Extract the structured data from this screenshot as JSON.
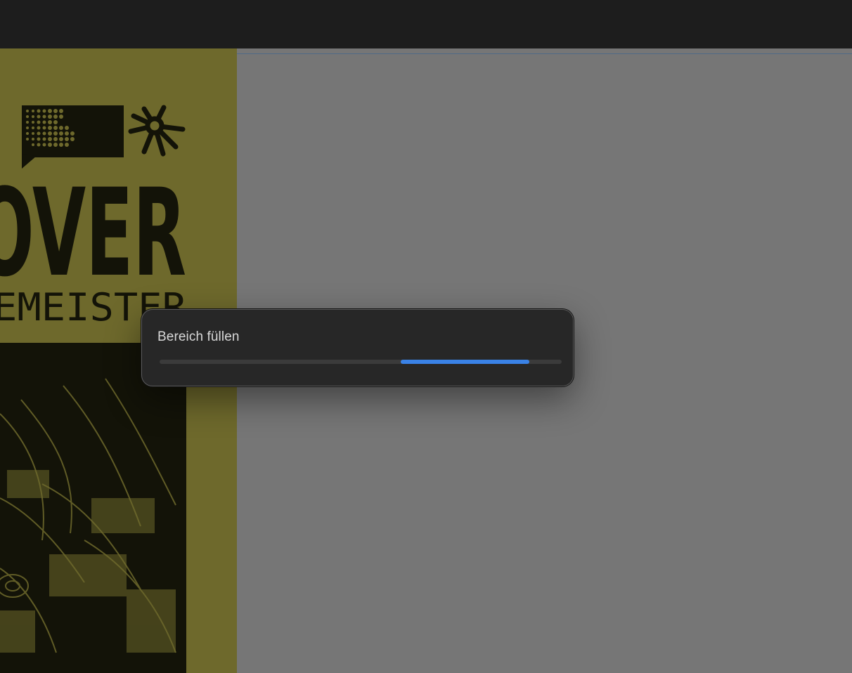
{
  "dialog": {
    "title": "Bereich füllen",
    "progress": {
      "mode": "indeterminate",
      "segment_start": 0.6,
      "segment_end": 0.92,
      "color": "#3a82e6"
    }
  },
  "artwork": {
    "headline": "OVER",
    "subline": "EMEISTER",
    "background_color": "#6e692c"
  },
  "colors": {
    "app_background": "#1d1d1d",
    "canvas_background": "#767676",
    "guide_line": "#4e6a86"
  }
}
